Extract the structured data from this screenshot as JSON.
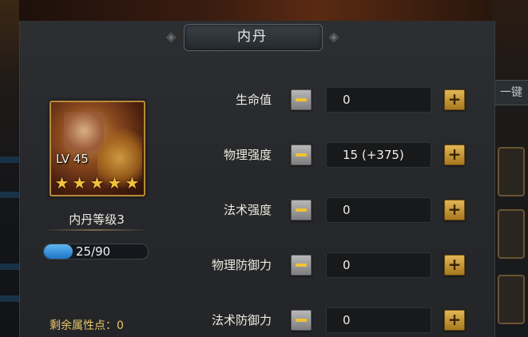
{
  "panel": {
    "title": "内丹"
  },
  "side": {
    "tab_label": "一键"
  },
  "hero": {
    "level_text": "LV 45",
    "stars": 5,
    "dan_level_label": "内丹等级3",
    "xp_text": "25/90",
    "xp_current": 25,
    "xp_max": 90,
    "remaining_points": "剩余属性点：0"
  },
  "stats": [
    {
      "label": "生命值",
      "value": "0"
    },
    {
      "label": "物理强度",
      "value": "15 (+375)"
    },
    {
      "label": "法术强度",
      "value": "0"
    },
    {
      "label": "物理防御力",
      "value": "0"
    },
    {
      "label": "法术防御力",
      "value": "0"
    }
  ],
  "colors": {
    "accent_gold": "#e8c66a",
    "xp_blue": "#3b95dc",
    "plus_button": "#e2b655",
    "minus_glyph": "#f2c232"
  }
}
